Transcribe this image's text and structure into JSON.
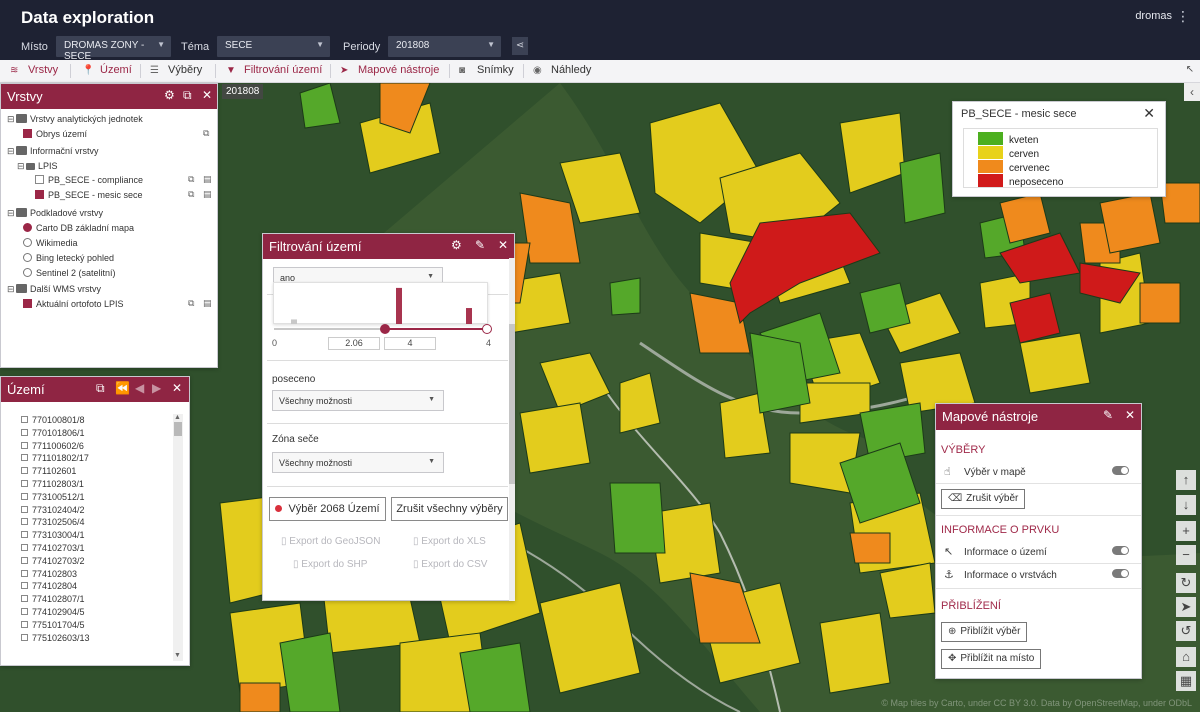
{
  "header": {
    "title": "Data exploration",
    "user": "dromas",
    "misto_label": "Místo",
    "misto_value": "DROMAS ZONY - SECE",
    "tema_label": "Téma",
    "tema_value": "SECE",
    "periody_label": "Periody",
    "periody_value": "201808"
  },
  "toolbar": {
    "items": [
      {
        "label": "Vrstvy",
        "icon": "layers-icon"
      },
      {
        "label": "Území",
        "icon": "pin-icon"
      },
      {
        "label": "Výběry",
        "icon": "list-icon"
      },
      {
        "label": "Filtrování území",
        "icon": "filter-icon"
      },
      {
        "label": "Mapové nástroje",
        "icon": "cursor-icon"
      },
      {
        "label": "Snímky",
        "icon": "camera-icon"
      },
      {
        "label": "Náhledy",
        "icon": "eye-icon"
      }
    ]
  },
  "map": {
    "period_tag": "201808",
    "attribution": "© Map tiles by Carto, under CC BY 3.0. Data by OpenStreetMap, under ODbL"
  },
  "vrstvy": {
    "title": "Vrstvy",
    "rows": [
      {
        "label": "Vrstvy analytických jednotek"
      },
      {
        "label": "Obrys území"
      },
      {
        "label": "Informační vrstvy"
      },
      {
        "label": "LPIS"
      },
      {
        "label": "PB_SECE - compliance"
      },
      {
        "label": "PB_SECE - mesic sece"
      },
      {
        "label": "Podkladové vrstvy"
      },
      {
        "label": "Carto DB základní mapa"
      },
      {
        "label": "Wikimedia"
      },
      {
        "label": "Bing letecký pohled"
      },
      {
        "label": "Sentinel 2 (satelitní)"
      },
      {
        "label": "Další WMS vrstvy"
      },
      {
        "label": "Aktuální ortofoto LPIS"
      }
    ]
  },
  "uzemi": {
    "title": "Území",
    "items": [
      "770100801/8",
      "770101806/1",
      "771100602/6",
      "771101802/17",
      "771102601",
      "771102803/1",
      "773100512/1",
      "773102404/2",
      "773102506/4",
      "773103004/1",
      "774102703/1",
      "774102703/2",
      "774102803",
      "774102804",
      "774102807/1",
      "774102904/5",
      "775101704/5",
      "775102603/13"
    ]
  },
  "filtr": {
    "title": "Filtrování území",
    "first_select": "ano",
    "slider_min": "0",
    "slider_low": "2.06",
    "slider_high": "4",
    "slider_max": "4",
    "poseceno_label": "poseceno",
    "poseceno_value": "Všechny možnosti",
    "zona_label": "Zóna seče",
    "zona_value": "Všechny možnosti",
    "select_btn": "Výběr 2068 Území",
    "clear_btn": "Zrušit všechny výběry",
    "export_geojson": "Export do GeoJSON",
    "export_xls": "Export do XLS",
    "export_shp": "Export do SHP",
    "export_csv": "Export do CSV",
    "histogram": [
      0.12,
      0.0,
      0.0,
      0.95,
      0.0,
      0.42
    ]
  },
  "legend": {
    "title": "PB_SECE - mesic sece",
    "items": [
      {
        "label": "kveten",
        "color": "#4caf1f"
      },
      {
        "label": "cerven",
        "color": "#e8d21a"
      },
      {
        "label": "cervenec",
        "color": "#f08a1c"
      },
      {
        "label": "neposeceno",
        "color": "#d11a1a"
      }
    ]
  },
  "tools": {
    "title": "Mapové nástroje",
    "vybery_title": "VÝBĚRY",
    "vyber_v_mape": "Výběr v mapě",
    "zrusit_vyber": "Zrušit výběr",
    "info_title": "INFORMACE O PRVKU",
    "info_uzemi": "Informace o území",
    "info_vrstvach": "Informace o vrstvách",
    "zoom_title": "PŘIBLÍŽENÍ",
    "priblizit_vyber": "Přiblížit výběr",
    "priblizit_misto": "Přiblížit na místo"
  },
  "colors": {
    "header_bg": "#1e2233",
    "accent": "#8f2543"
  }
}
